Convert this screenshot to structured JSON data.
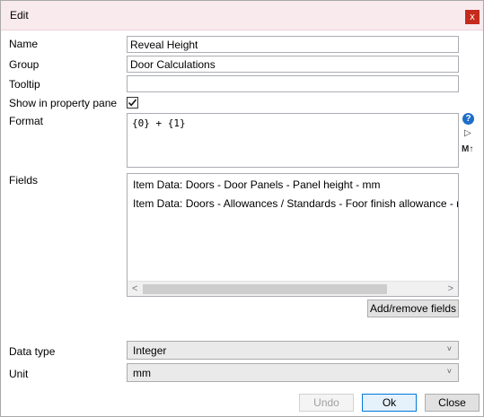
{
  "window": {
    "title": "Edit",
    "close_glyph": "x"
  },
  "form": {
    "name_label": "Name",
    "name_value": "Reveal Height",
    "group_label": "Group",
    "group_value": "Door Calculations",
    "tooltip_label": "Tooltip",
    "tooltip_value": "",
    "show_label": "Show in property pane",
    "show_checked": true,
    "format_label": "Format",
    "format_value": "{0} + {1}",
    "fields_label": "Fields",
    "fields": [
      "Item Data: Doors - Door Panels - Panel height - mm",
      "Item Data: Doors - Allowances / Standards - Foor finish allowance - mm"
    ],
    "add_remove_label": "Add/remove fields",
    "datatype_label": "Data type",
    "datatype_value": "Integer",
    "unit_label": "Unit",
    "unit_value": "mm"
  },
  "icons": {
    "help": "help-icon",
    "preview": "play-icon",
    "markdown": "markdown-icon"
  },
  "footer": {
    "undo_label": "Undo",
    "ok_label": "Ok",
    "close_label": "Close"
  },
  "colors": {
    "titlebar": "#f9eaee",
    "close": "#c42b1c",
    "help": "#1e6ec8",
    "ok_border": "#0078d7"
  }
}
